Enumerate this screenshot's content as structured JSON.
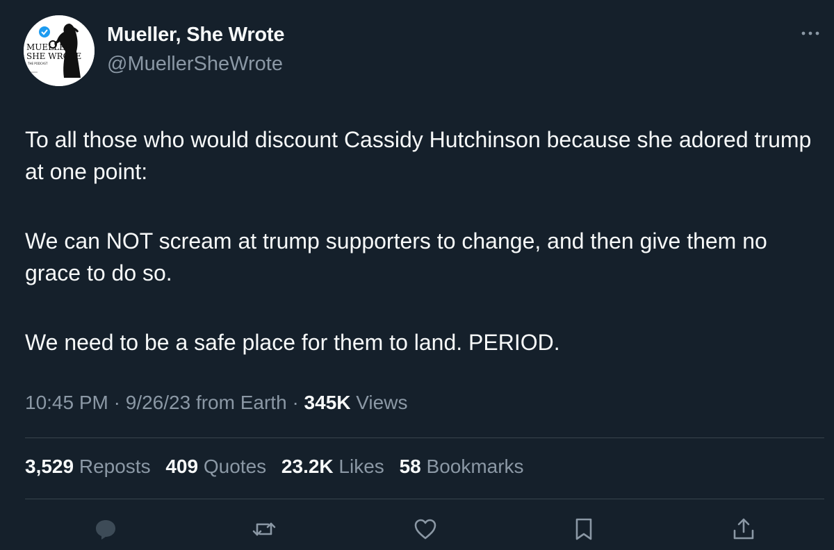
{
  "author": {
    "name": "Mueller, She Wrote",
    "handle": "@MuellerSheWrote",
    "avatar_text": [
      "MUELLER,",
      "SHE WROTE",
      "THE PODCAST"
    ],
    "verified_icon": "verified-badge-icon"
  },
  "tweet": {
    "paragraphs": [
      "To all those who would discount Cassidy Hutchinson because she adored trump at one point:",
      "We can NOT scream at trump supporters to change, and then give them no grace to do so.",
      "We need to be a safe place for them to land. PERIOD."
    ],
    "time": "10:45 PM",
    "date": "9/26/23",
    "source": "from Earth",
    "views_count": "345K",
    "views_label": "Views"
  },
  "stats": {
    "reposts_count": "3,529",
    "reposts_label": "Reposts",
    "quotes_count": "409",
    "quotes_label": "Quotes",
    "likes_count": "23.2K",
    "likes_label": "Likes",
    "bookmarks_count": "58",
    "bookmarks_label": "Bookmarks"
  },
  "actions": [
    "reply-icon",
    "repost-icon",
    "like-icon",
    "bookmark-icon",
    "share-icon"
  ],
  "colors": {
    "background": "#15202b",
    "text": "#f7f9f9",
    "secondary": "#8b98a5",
    "divider": "#38444d",
    "verified": "#1d9bf0",
    "reply_icon": "#3d4b57"
  }
}
